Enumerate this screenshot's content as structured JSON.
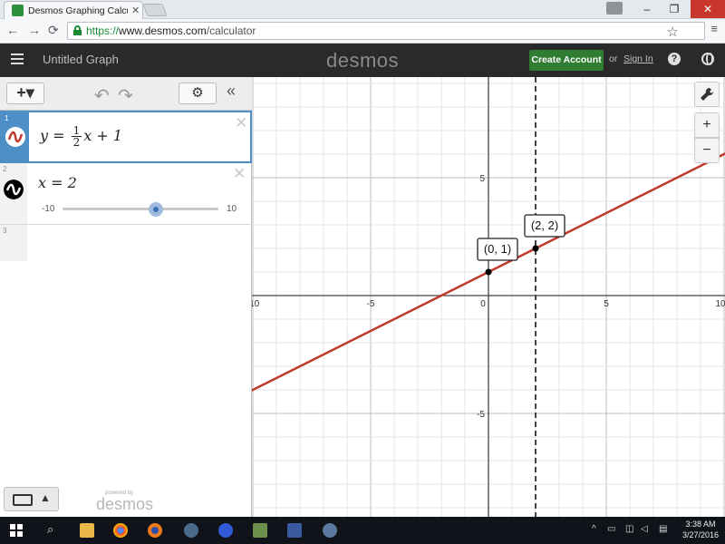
{
  "browser": {
    "tab_title": "Desmos Graphing Calculato",
    "tab_close": "✕",
    "url_scheme": "https://",
    "url_host": "www.desmos.com",
    "url_path": "/calculator",
    "win_min": "–",
    "win_restore": "❐",
    "win_close": "✕"
  },
  "header": {
    "graph_title": "Untitled Graph",
    "logo": "desmos",
    "create_account": "Create Account",
    "or": "or",
    "sign_in": "Sign In",
    "help": "?"
  },
  "toolbar": {
    "add": "+▾",
    "undo": "↶",
    "redo": "↷",
    "settings": "⚙",
    "collapse": "«"
  },
  "expressions": [
    {
      "index": "1",
      "lhs": "y",
      "eq": " = ",
      "num": "1",
      "den": "2",
      "rest": "x + 1",
      "color": "#c0392b"
    },
    {
      "index": "2",
      "latex": "x = 2",
      "slider_min": "-10",
      "slider_max": "10",
      "slider_value": 2,
      "color": "#000000"
    },
    {
      "index": "3"
    }
  ],
  "keypad": {
    "caret": "▲"
  },
  "powered_by": "powered by",
  "powered_logo": "desmos",
  "graph_controls": {
    "wrench": "🔧",
    "zoom_in": "+",
    "zoom_out": "−"
  },
  "chart_data": {
    "type": "line",
    "xlim": [
      -10,
      10
    ],
    "ylim": [
      -10,
      5
    ],
    "x_ticks": [
      "-10",
      "-5",
      "0",
      "5",
      "10"
    ],
    "y_ticks": [
      "5",
      "-5"
    ],
    "grid": true,
    "series": [
      {
        "name": "y = 1/2 x + 1",
        "slope": 0.5,
        "intercept": 1,
        "color": "#c0392b"
      }
    ],
    "vertical_lines": [
      {
        "x": 2,
        "style": "dashed",
        "color": "#444444"
      }
    ],
    "points": [
      {
        "x": 0,
        "y": 1,
        "label": "(0, 1)"
      },
      {
        "x": 2,
        "y": 2,
        "label": "(2, 2)"
      }
    ]
  },
  "taskbar": {
    "clock_time": "3:38 AM",
    "clock_date": "3/27/2016"
  },
  "colors": {
    "header_bg": "#2a2a2a",
    "create_btn": "#2e7d32",
    "active_blue": "#4f8fc8"
  }
}
